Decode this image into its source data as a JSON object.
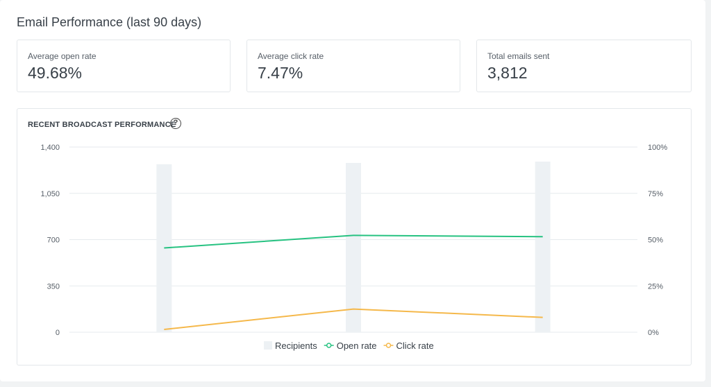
{
  "header": {
    "title": "Email Performance (last 90 days)"
  },
  "stats": [
    {
      "label": "Average open rate",
      "value": "49.68%"
    },
    {
      "label": "Average click rate",
      "value": "7.47%"
    },
    {
      "label": "Total emails sent",
      "value": "3,812"
    }
  ],
  "chart_section": {
    "title": "RECENT BROADCAST PERFORMANCE",
    "help_icon": "question-circle-icon"
  },
  "chart_data": {
    "type": "bar",
    "categories": [
      "",
      "",
      ""
    ],
    "left_axis": {
      "ticks": [
        "0",
        "350",
        "700",
        "1,050",
        "1,400"
      ],
      "range": [
        0,
        1400
      ]
    },
    "right_axis": {
      "ticks": [
        "0%",
        "25%",
        "50%",
        "75%",
        "100%"
      ],
      "range": [
        0,
        100
      ]
    },
    "series": [
      {
        "name": "Recipients",
        "kind": "bar",
        "axis": "left",
        "values": [
          1270,
          1280,
          1290
        ],
        "color": "#edf1f4"
      },
      {
        "name": "Open rate",
        "kind": "line",
        "axis": "right",
        "values": [
          45.5,
          52.3,
          51.6
        ],
        "color": "#26c281"
      },
      {
        "name": "Click rate",
        "kind": "line",
        "axis": "right",
        "values": [
          1.5,
          12.5,
          8.0
        ],
        "color": "#f5b84a"
      }
    ],
    "legend_position": "bottom",
    "grid": true
  }
}
